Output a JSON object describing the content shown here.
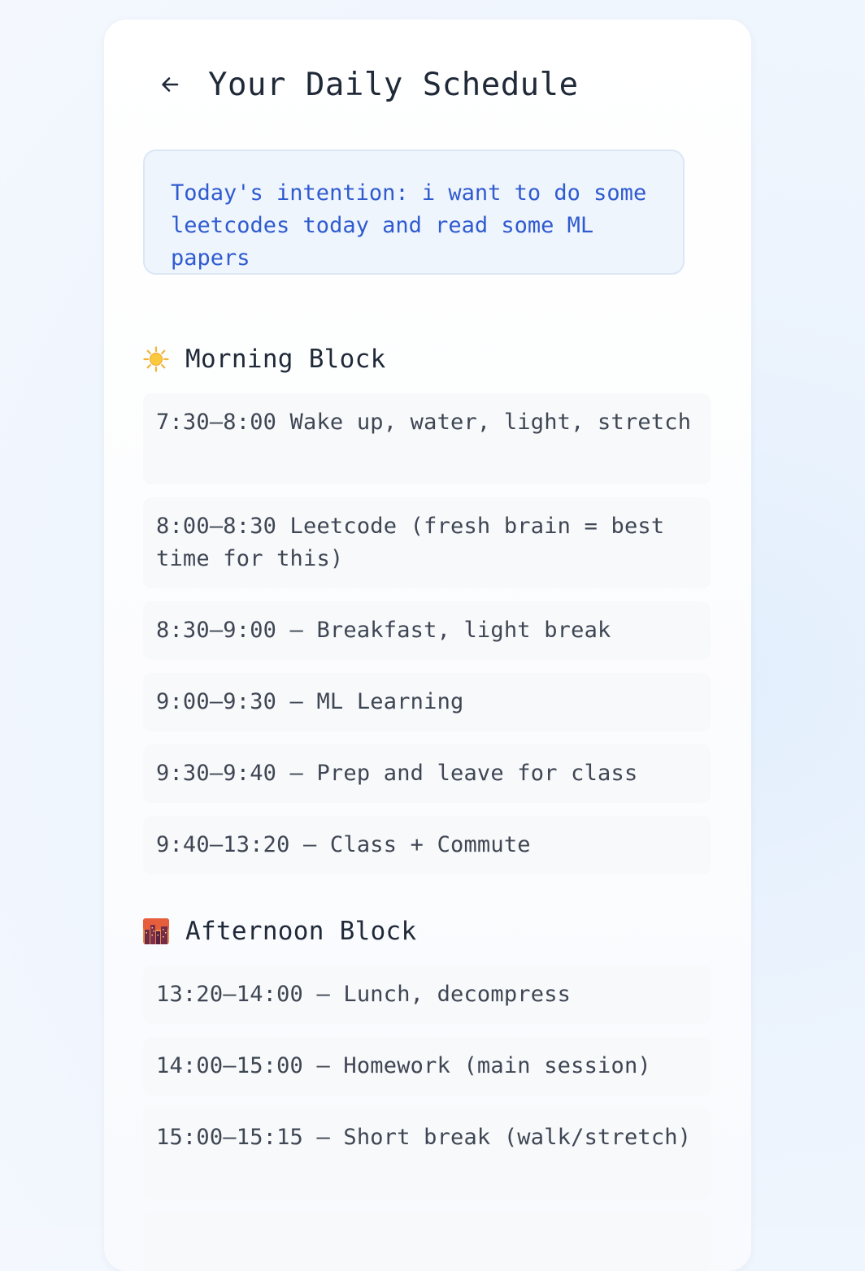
{
  "header": {
    "back_icon": "arrow-left-icon",
    "title": "Your Daily Schedule"
  },
  "intention": {
    "text": "Today's intention: i want to do some leetcodes today and read some ML papers"
  },
  "morning": {
    "icon": "sun-icon",
    "title": "Morning Block",
    "items": [
      "7:30–8:00 Wake up, water, light, stretch",
      "8:00–8:30 Leetcode (fresh brain = best time for this)",
      "8:30–9:00 — Breakfast, light break",
      "9:00–9:30 — ML Learning",
      "9:30–9:40 — Prep and leave for class",
      "9:40–13:20 — Class + Commute"
    ]
  },
  "afternoon": {
    "icon": "city-sunset-icon",
    "title": "Afternoon Block",
    "items": [
      "13:20–14:00 — Lunch, decompress",
      "14:00–15:00 — Homework (main session)",
      "15:00–15:15 — Short break (walk/stretch)"
    ]
  },
  "colors": {
    "intention_text": "#2f5bd0",
    "intention_bg": "#eff5fd",
    "item_bg": "#f7f9fb"
  }
}
